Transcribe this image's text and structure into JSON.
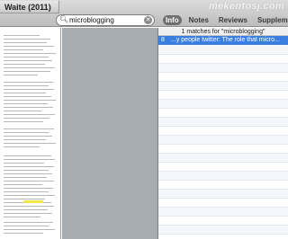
{
  "document": {
    "title": "Waite (2011)"
  },
  "watermark": "mekentosj.com",
  "search": {
    "value": "microblogging"
  },
  "tabs": [
    {
      "label": "Info",
      "active": true
    },
    {
      "label": "Notes",
      "active": false
    },
    {
      "label": "Reviews",
      "active": false
    },
    {
      "label": "Supplements",
      "active": false
    }
  ],
  "results": {
    "header": "1 matches for \"microblogging\"",
    "rows": [
      {
        "page": "8",
        "snippet": "...y people twitter: The role that micro..."
      }
    ]
  },
  "icons": {
    "search": "search-icon",
    "clear": "clear-icon"
  },
  "colors": {
    "selection": "#3a7fe0",
    "active_tab": "#6e6e6e",
    "highlight": "#f2e64a"
  }
}
